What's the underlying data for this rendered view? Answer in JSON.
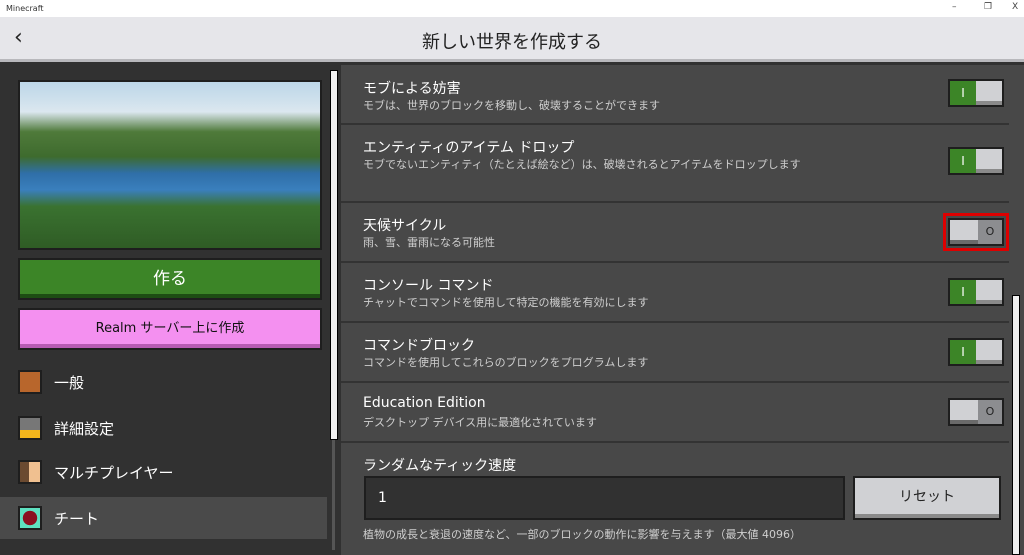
{
  "window": {
    "title": "Minecraft",
    "minimize": "–",
    "restore": "❐",
    "close": "X"
  },
  "header": {
    "back": "‹",
    "title": "新しい世界を作成する"
  },
  "left": {
    "create_label": "作る",
    "realm_label": "Realm サーバー上に作成",
    "nav": [
      {
        "label": "一般",
        "icon": "gear-icon",
        "color": "#b8662c"
      },
      {
        "label": "詳細設定",
        "icon": "furnace-icon",
        "color": "#777"
      },
      {
        "label": "マルチプレイヤー",
        "icon": "players-icon",
        "color": "#e0a070"
      },
      {
        "label": "チート",
        "icon": "command-block-icon",
        "color": "#8a1020"
      }
    ],
    "selected": "チート"
  },
  "settings": [
    {
      "title": "モブによる妨害",
      "desc": "モブは、世界のブロックを移動し、破壊することができます",
      "on": true
    },
    {
      "title": "エンティティのアイテム ドロップ",
      "desc": "モブでないエンティティ（たとえば絵など）は、破壊されるとアイテムをドロップします",
      "on": true
    },
    {
      "title": "天候サイクル",
      "desc": "雨、雪、雷雨になる可能性",
      "on": false
    },
    {
      "title": "コンソール コマンド",
      "desc": "チャットでコマンドを使用して特定の機能を有効にします",
      "on": true
    },
    {
      "title": "コマンドブロック",
      "desc": "コマンドを使用してこれらのブロックをプログラムします",
      "on": true
    },
    {
      "title": "Education Edition",
      "desc": "デスクトップ デバイス用に最適化されています",
      "on": false
    }
  ],
  "toggle": {
    "on_glyph": "I",
    "off_glyph": "O"
  },
  "tick": {
    "title": "ランダムなティック速度",
    "value": "1",
    "reset_label": "リセット",
    "desc": "植物の成長と衰退の速度など、一部のブロックの動作に影響を与えます（最大値 4096）"
  }
}
